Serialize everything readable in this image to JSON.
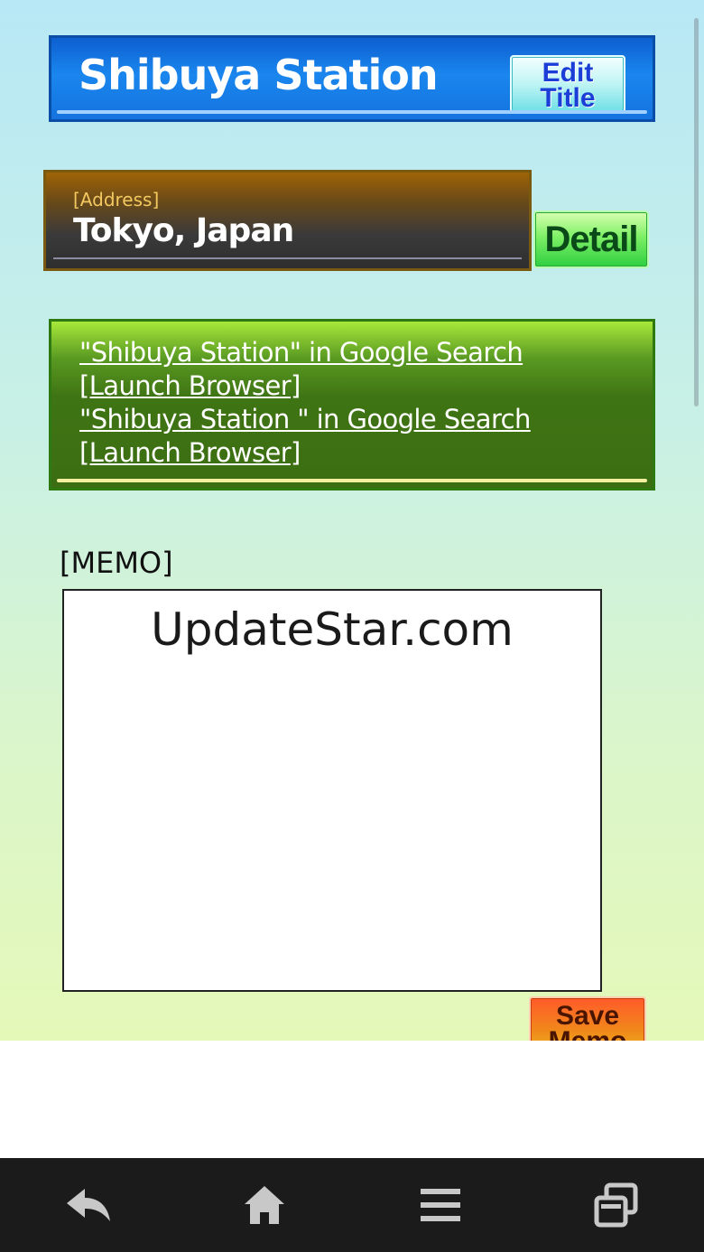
{
  "header": {
    "title": "Shibuya Station",
    "edit_title_line1": "Edit",
    "edit_title_line2": "Title"
  },
  "address": {
    "label": "[Address]",
    "value": "Tokyo, Japan",
    "detail_label": "Detail"
  },
  "search": {
    "links": [
      {
        "text": "\"Shibuya Station\" in Google Search",
        "launch": "[Launch Browser]"
      },
      {
        "text": "\"Shibuya Station \" in Google Search",
        "launch": "[Launch Browser]"
      }
    ]
  },
  "memo": {
    "label": "[MEMO]",
    "content": "UpdateStar.com",
    "save_line1": "Save",
    "save_line2": "Memo"
  },
  "navbar": {
    "icons": [
      "back-icon",
      "home-icon",
      "menu-icon",
      "recent-apps-icon"
    ]
  },
  "colors": {
    "title_blue": "#1a86ee",
    "address_brown": "#6a4a18",
    "search_green": "#3f7414",
    "detail_green": "#2fcf42",
    "save_orange": "#f08a1a",
    "nav_bg": "#1b1b1b"
  }
}
